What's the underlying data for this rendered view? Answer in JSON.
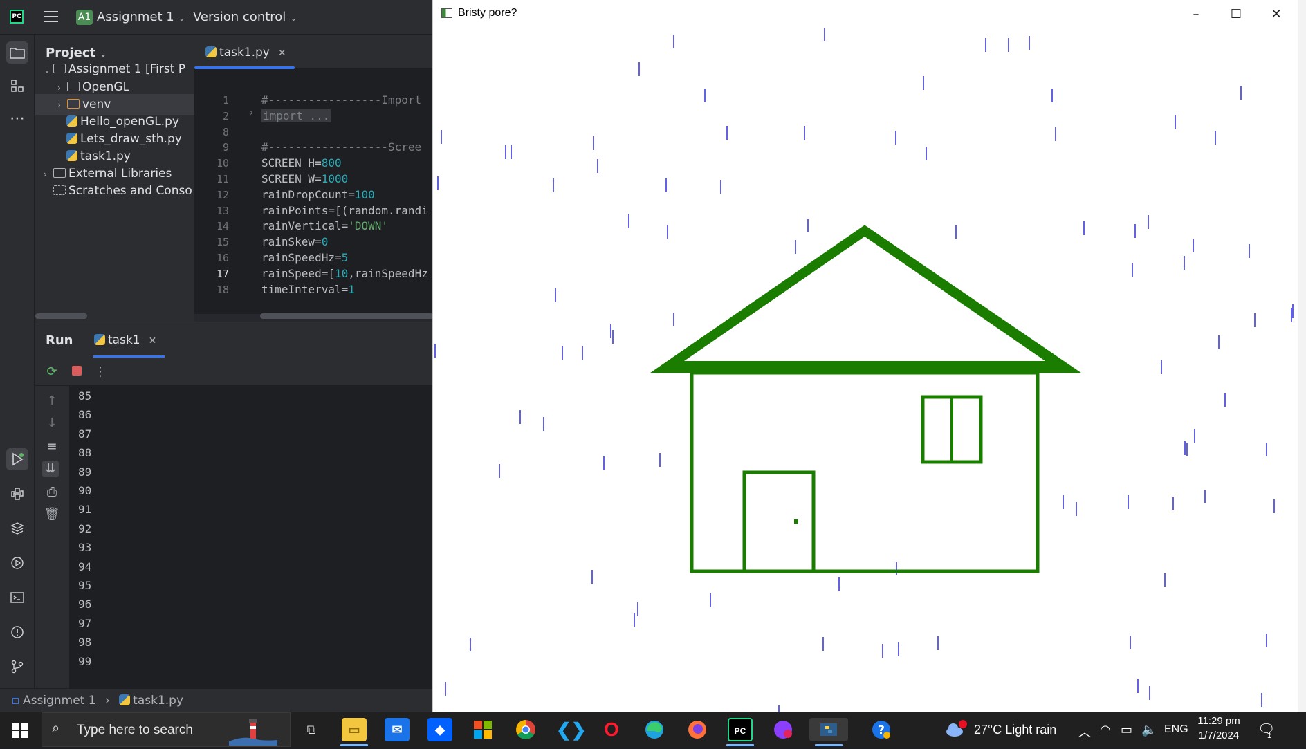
{
  "titlebar": {
    "project_badge": "A1",
    "project_name": "Assignmet 1",
    "vcs": "Version control"
  },
  "project_panel": {
    "title": "Project",
    "tree": [
      {
        "label": "Assignmet 1 [First P",
        "type": "folder",
        "expanded": true
      },
      {
        "label": "OpenGL",
        "type": "folder"
      },
      {
        "label": "venv",
        "type": "folder-orange"
      },
      {
        "label": "Hello_openGL.py",
        "type": "python"
      },
      {
        "label": "Lets_draw_sth.py",
        "type": "python"
      },
      {
        "label": "task1.py",
        "type": "python"
      },
      {
        "label": "External Libraries",
        "type": "library"
      },
      {
        "label": "Scratches and Conso",
        "type": "scratches"
      }
    ]
  },
  "editor": {
    "tab": "task1.py",
    "line_numbers": [
      "1",
      "2",
      "8",
      "9",
      "10",
      "11",
      "12",
      "13",
      "14",
      "15",
      "16",
      "17",
      "18"
    ],
    "current_line": "17",
    "lines": [
      {
        "text": "#-----------------Import",
        "kind": "comment"
      },
      {
        "text": "import ...",
        "kind": "fold"
      },
      {
        "text": "",
        "kind": "plain"
      },
      {
        "text": "#------------------Scree",
        "kind": "comment"
      },
      {
        "text": "SCREEN_H=800",
        "kind": "assign"
      },
      {
        "text": "SCREEN_W=1000",
        "kind": "assign"
      },
      {
        "text": "rainDropCount=100",
        "kind": "assign"
      },
      {
        "text": "rainPoints=[(random.randi",
        "kind": "plain"
      },
      {
        "text": "rainVertical='DOWN'",
        "kind": "string"
      },
      {
        "text": "rainSkew=0",
        "kind": "assign"
      },
      {
        "text": "rainSpeedHz=5",
        "kind": "assign"
      },
      {
        "text": "rainSpeed=[10,rainSpeedHz",
        "kind": "plain"
      },
      {
        "text": "timeInterval=1",
        "kind": "assign"
      }
    ]
  },
  "run_panel": {
    "title": "Run",
    "tab": "task1",
    "output_lines": [
      "85",
      "86",
      "87",
      "88",
      "89",
      "90",
      "91",
      "92",
      "93",
      "94",
      "95",
      "96",
      "97",
      "98",
      "99"
    ]
  },
  "statusbar": {
    "project": "Assignmet 1",
    "file": "task1.py"
  },
  "python_window": {
    "title": "Bristy pore?",
    "house_color": "#1a7d00",
    "rain_color": "#3a3adb",
    "background_color": "#ffffff"
  },
  "taskbar": {
    "search_placeholder": "Type here to search",
    "weather": "27°C  Light rain",
    "language": "ENG",
    "time": "11:29 pm",
    "date": "1/7/2024",
    "notification_count": "1"
  }
}
